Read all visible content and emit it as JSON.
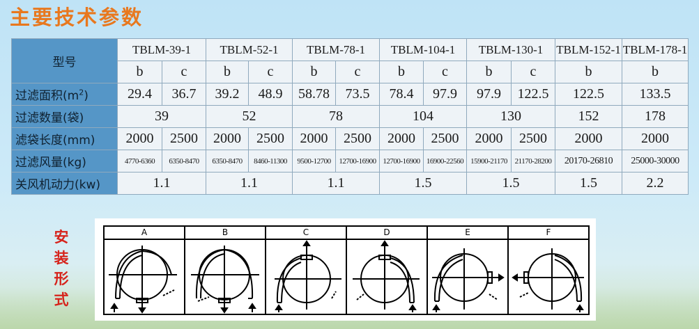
{
  "title": "主要技术参数",
  "table": {
    "header_label": "型号",
    "models": [
      "TBLM-39-1",
      "TBLM-52-1",
      "TBLM-78-1",
      "TBLM-104-1",
      "TBLM-130-1",
      "TBLM-152-1",
      "TBLM-178-1"
    ],
    "variants": [
      "b",
      "c",
      "b",
      "c",
      "b",
      "c",
      "b",
      "c",
      "b",
      "c",
      "b",
      "b"
    ],
    "rows": {
      "area": {
        "label": "过滤面积(m²)",
        "values": [
          "29.4",
          "36.7",
          "39.2",
          "48.9",
          "58.78",
          "73.5",
          "78.4",
          "97.9",
          "97.9",
          "122.5",
          "122.5",
          "133.5"
        ]
      },
      "bags": {
        "label": "过滤数量(袋)",
        "values": [
          "39",
          "52",
          "78",
          "104",
          "130",
          "152",
          "178"
        ]
      },
      "length": {
        "label": "滤袋长度(mm)",
        "values": [
          "2000",
          "2500",
          "2000",
          "2500",
          "2000",
          "2500",
          "2000",
          "2500",
          "2000",
          "2500",
          "2000",
          "2000"
        ]
      },
      "airflow": {
        "label": "过滤风量(kg)",
        "values": [
          "4770-6360",
          "6350-8470",
          "6350-8470",
          "8460-11300",
          "9500-12700",
          "12700-16900",
          "12700-16900",
          "16900-22560",
          "15900-21170",
          "21170-28200",
          "20170-26810",
          "25000-30000"
        ]
      },
      "power": {
        "label": "关风机动力(kw)",
        "values": [
          "1.1",
          "1.1",
          "1.1",
          "1.5",
          "1.5",
          "1.5",
          "2.2"
        ]
      }
    }
  },
  "install": {
    "label_chars": [
      "安",
      "装",
      "形",
      "式"
    ],
    "types": [
      "A",
      "B",
      "C",
      "D",
      "E",
      "F"
    ]
  }
}
